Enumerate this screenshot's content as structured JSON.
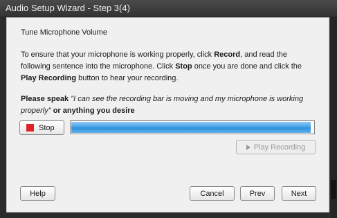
{
  "window": {
    "title": "Audio Setup Wizard - Step 3(4)"
  },
  "content": {
    "heading": "Tune Microphone Volume",
    "instructions": {
      "t1": "To ensure that your microphone is working properly, click ",
      "record": "Record",
      "t2": ", and read the following sentence into the microphone. Click ",
      "stop": "Stop",
      "t3": " once you are done and click the ",
      "play": "Play Recording",
      "t4": " button to hear your recording."
    },
    "speak": {
      "lead": "Please speak",
      "quote": "\"I can see the recording bar is moving and my microphone is working properly\"",
      "tail": " or anything you desire"
    }
  },
  "controls": {
    "stop_label": "Stop",
    "play_recording_label": "Play Recording",
    "recording_level": 0.99
  },
  "footer": {
    "help": "Help",
    "cancel": "Cancel",
    "prev": "Prev",
    "next": "Next"
  },
  "colors": {
    "stop_icon": "#e02424",
    "progress_fill": "#3a9ae2"
  },
  "icons": [
    "stop-icon",
    "play-icon"
  ]
}
